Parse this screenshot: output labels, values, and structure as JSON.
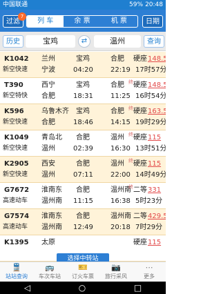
{
  "status": {
    "carrier": "中国联通",
    "time": "20:48",
    "battery": "59%"
  },
  "header": {
    "filter_label": "过滤",
    "filter_badge": "7",
    "tabs": [
      "列 车",
      "余 票",
      "机 票"
    ],
    "date_label": "日期"
  },
  "search": {
    "history_label": "历史",
    "from": "宝鸡",
    "to": "温州",
    "query_label": "查询"
  },
  "trains": [
    {
      "train": "K1042",
      "type": "新空快速",
      "from": "兰州",
      "to": "宁波",
      "mid1": "宝鸡",
      "dep": "04:20",
      "mid2": "合肥",
      "arr": "22:19",
      "seat": "硬座",
      "price": "148.5",
      "dur": "17时57分",
      "mark": ""
    },
    {
      "train": "T390",
      "type": "新空特快",
      "from": "西宁",
      "to": "合肥",
      "mid1": "宝鸡",
      "dep": "18:31",
      "mid2": "合肥",
      "arr": "11:25",
      "seat": "硬座",
      "price": "148.5",
      "dur": "16时54分",
      "mark": "终"
    },
    {
      "train": "K596",
      "type": "新空快速",
      "from": "乌鲁木齐",
      "to": "合肥",
      "mid1": "宝鸡",
      "dep": "18:46",
      "mid2": "合肥",
      "arr": "14:15",
      "seat": "硬座",
      "price": "163.5",
      "dur": "19时29分",
      "mark": "终"
    },
    {
      "train": "K1049",
      "type": "新空快速",
      "from": "青岛北",
      "to": "温州",
      "mid1": "合肥",
      "dep": "02:39",
      "mid2": "温州",
      "arr": "16:30",
      "seat": "硬座",
      "price": "115",
      "dur": "13时51分",
      "mark": "终"
    },
    {
      "train": "K2905",
      "type": "新空快速",
      "from": "西安",
      "to": "温州",
      "mid1": "合肥",
      "dep": "07:11",
      "mid2": "温州",
      "arr": "22:00",
      "seat": "硬座",
      "price": "115",
      "dur": "14时49分",
      "mark": "终"
    },
    {
      "train": "G7672",
      "type": "高速动车",
      "from": "淮南东",
      "to": "温州南",
      "mid1": "合肥",
      "dep": "11:15",
      "mid2": "温州南",
      "arr": "16:38",
      "seat": "二等",
      "price": "331",
      "dur": "5时23分",
      "mark": "终"
    },
    {
      "train": "G7574",
      "type": "高速动车",
      "from": "淮南东",
      "to": "温州南",
      "mid1": "合肥",
      "dep": "12:49",
      "mid2": "温州南",
      "arr": "20:18",
      "seat": "二等",
      "price": "429.5",
      "dur": "7时29分",
      "mark": ""
    },
    {
      "train": "K1395",
      "type": "",
      "from": "太原",
      "to": "",
      "mid1": "",
      "dep": "",
      "mid2": "",
      "arr": "",
      "seat": "硬座",
      "price": "115",
      "dur": "",
      "mark": ""
    }
  ],
  "transfer_button": "选择中转站",
  "bottom_nav": [
    {
      "label": "站站查询",
      "icon": "train-icon"
    },
    {
      "label": "车次车站",
      "icon": "bus-icon"
    },
    {
      "label": "订火车票",
      "icon": "ticket-icon"
    },
    {
      "label": "旅行采风",
      "icon": "camera-icon"
    },
    {
      "label": "更多",
      "icon": "more-icon"
    }
  ]
}
